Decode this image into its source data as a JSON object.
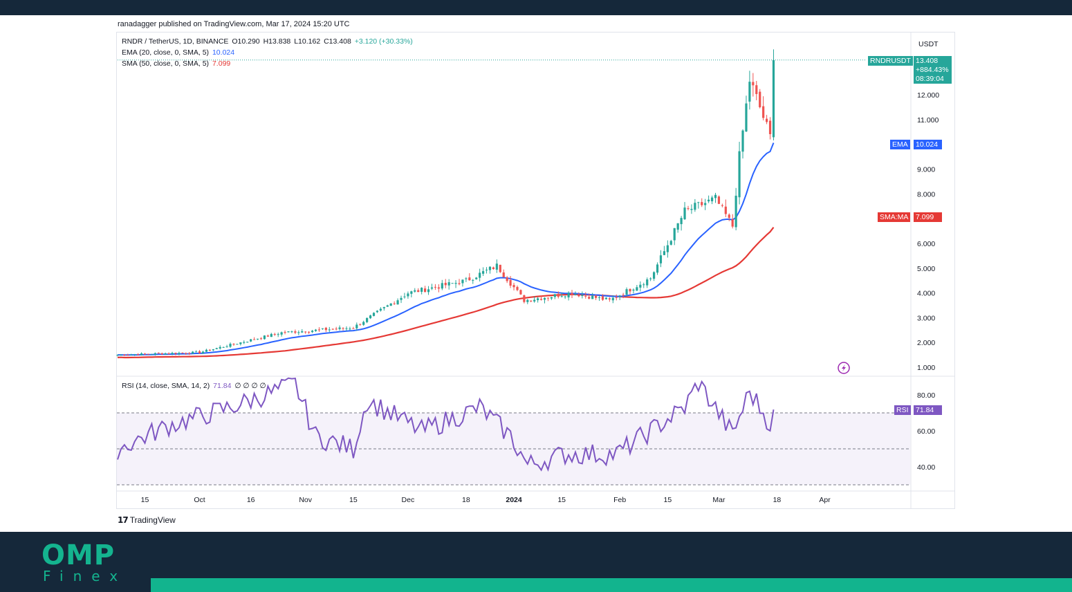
{
  "header": {
    "publisher": "ranadagger published on TradingView.com, Mar 17, 2024 15:20 UTC"
  },
  "legend": {
    "symbol": "RNDR / TetherUS, 1D, BINANCE",
    "open": "O10.290",
    "high": "H13.838",
    "low": "L10.162",
    "close": "C13.408",
    "change": "+3.120 (+30.33%)",
    "ema_label": "EMA (20, close, 0, SMA, 5)",
    "ema_value": "10.024",
    "sma_label": "SMA (50, close, 0, SMA, 5)",
    "sma_value": "7.099",
    "rsi_label": "RSI (14, close, SMA, 14, 2)",
    "rsi_value": "71.84",
    "rsi_extra": "∅ ∅ ∅ ∅"
  },
  "axis": {
    "currency": "USDT",
    "price_ticks": [
      "1.000",
      "2.000",
      "3.000",
      "4.000",
      "5.000",
      "6.000",
      "8.000",
      "9.000",
      "11.000",
      "12.000"
    ],
    "rsi_ticks": [
      "40.00",
      "60.00",
      "80.00"
    ],
    "time_ticks": [
      "15",
      "Oct",
      "16",
      "Nov",
      "15",
      "Dec",
      "18",
      "2024",
      "15",
      "Feb",
      "15",
      "Mar",
      "18",
      "Apr"
    ]
  },
  "tags": {
    "price_symbol": "RNDRUSDT",
    "price": "13.408",
    "change_pct": "+884.43%",
    "countdown": "08:39:04",
    "ema_name": "EMA",
    "ema_value": "10.024",
    "sma_name": "SMA:MA",
    "sma_value": "7.099",
    "rsi_name": "RSI",
    "rsi_value": "71.84"
  },
  "branding": {
    "tv": "TradingView",
    "logo_top": "OMP",
    "logo_bottom": "Finex"
  },
  "colors": {
    "up": "#26a69a",
    "down": "#ef5350",
    "ema": "#2962ff",
    "sma": "#e53935",
    "rsi": "#7e57c2",
    "tag_green": "#26a69a",
    "brand": "#14b48f",
    "navy": "#15283a"
  },
  "chart_data": {
    "type": "candlestick",
    "title": "RNDR / TetherUS, 1D, BINANCE",
    "price_range": [
      1.0,
      13.84
    ],
    "rsi_range": [
      40,
      80
    ],
    "x": [
      "2023-09-07",
      "2024-03-17"
    ],
    "price_keypoints": {
      "dates": [
        "2023-09-07",
        "2023-10-01",
        "2023-10-25",
        "2023-11-15",
        "2023-12-01",
        "2023-12-18",
        "2023-12-27",
        "2024-01-04",
        "2024-01-18",
        "2024-01-29",
        "2024-02-10",
        "2024-02-20",
        "2024-02-29",
        "2024-03-05",
        "2024-03-07",
        "2024-03-10",
        "2024-03-13",
        "2024-03-16",
        "2024-03-17"
      ],
      "values": [
        1.5,
        1.6,
        2.4,
        2.6,
        4.0,
        4.5,
        5.1,
        3.7,
        4.0,
        3.7,
        4.6,
        7.3,
        7.8,
        6.7,
        9.5,
        12.6,
        11.5,
        10.3,
        13.408
      ]
    },
    "ema20": {
      "name": "EMA",
      "last": 10.024
    },
    "sma50": {
      "name": "SMA:MA",
      "last": 7.099
    },
    "rsi": {
      "name": "RSI",
      "last": 71.84,
      "keypoints": {
        "dates": [
          "2023-09-07",
          "2023-09-22",
          "2023-10-10",
          "2023-10-29",
          "2023-11-04",
          "2023-11-15",
          "2023-11-19",
          "2023-12-05",
          "2023-12-22",
          "2023-12-31",
          "2024-01-05",
          "2024-01-16",
          "2024-01-31",
          "2024-02-20",
          "2024-02-24",
          "2024-03-05",
          "2024-03-10",
          "2024-03-16",
          "2024-03-17"
        ],
        "values": [
          50,
          63,
          73,
          86,
          57,
          50,
          77,
          60,
          73,
          57,
          41,
          47,
          47,
          73,
          87,
          58,
          82,
          64,
          71.84
        ]
      }
    }
  }
}
